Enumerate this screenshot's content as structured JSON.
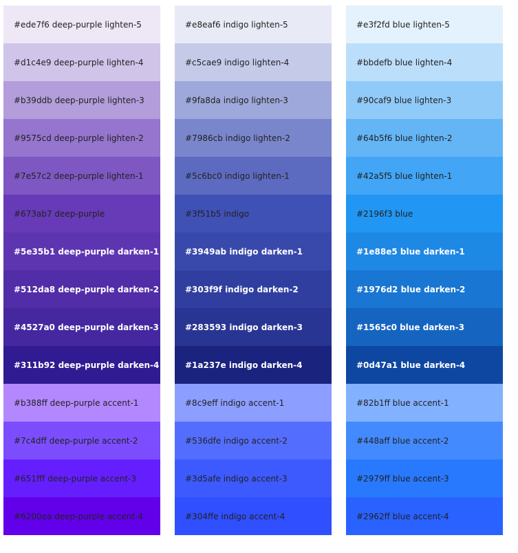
{
  "columns": [
    {
      "name": "deep-purple",
      "swatches": [
        {
          "color": "#ede7f6",
          "label": "#ede7f6 deep-purple lighten-5",
          "text": "light"
        },
        {
          "color": "#d1c4e9",
          "label": "#d1c4e9 deep-purple lighten-4",
          "text": "light"
        },
        {
          "color": "#b39ddb",
          "label": "#b39ddb deep-purple lighten-3",
          "text": "light"
        },
        {
          "color": "#9575cd",
          "label": "#9575cd deep-purple lighten-2",
          "text": "light"
        },
        {
          "color": "#7e57c2",
          "label": "#7e57c2 deep-purple lighten-1",
          "text": "light"
        },
        {
          "color": "#673ab7",
          "label": "#673ab7 deep-purple",
          "text": "light"
        },
        {
          "color": "#5e35b1",
          "label": "#5e35b1 deep-purple darken-1",
          "text": "dark"
        },
        {
          "color": "#512da8",
          "label": "#512da8 deep-purple darken-2",
          "text": "dark"
        },
        {
          "color": "#4527a0",
          "label": "#4527a0 deep-purple darken-3",
          "text": "dark"
        },
        {
          "color": "#311b92",
          "label": "#311b92 deep-purple darken-4",
          "text": "dark"
        },
        {
          "color": "#b388ff",
          "label": "#b388ff deep-purple accent-1",
          "text": "light"
        },
        {
          "color": "#7c4dff",
          "label": "#7c4dff deep-purple accent-2",
          "text": "light"
        },
        {
          "color": "#651fff",
          "label": "#651fff deep-purple accent-3",
          "text": "light"
        },
        {
          "color": "#6200ea",
          "label": "#6200ea deep-purple accent-4",
          "text": "light"
        }
      ]
    },
    {
      "name": "indigo",
      "swatches": [
        {
          "color": "#e8eaf6",
          "label": "#e8eaf6 indigo lighten-5",
          "text": "light"
        },
        {
          "color": "#c5cae9",
          "label": "#c5cae9 indigo lighten-4",
          "text": "light"
        },
        {
          "color": "#9fa8da",
          "label": "#9fa8da indigo lighten-3",
          "text": "light"
        },
        {
          "color": "#7986cb",
          "label": "#7986cb indigo lighten-2",
          "text": "light"
        },
        {
          "color": "#5c6bc0",
          "label": "#5c6bc0 indigo lighten-1",
          "text": "light"
        },
        {
          "color": "#3f51b5",
          "label": "#3f51b5 indigo",
          "text": "light"
        },
        {
          "color": "#3949ab",
          "label": "#3949ab indigo darken-1",
          "text": "dark"
        },
        {
          "color": "#303f9f",
          "label": "#303f9f indigo darken-2",
          "text": "dark"
        },
        {
          "color": "#283593",
          "label": "#283593 indigo darken-3",
          "text": "dark"
        },
        {
          "color": "#1a237e",
          "label": "#1a237e indigo darken-4",
          "text": "dark"
        },
        {
          "color": "#8c9eff",
          "label": "#8c9eff indigo accent-1",
          "text": "light"
        },
        {
          "color": "#536dfe",
          "label": "#536dfe indigo accent-2",
          "text": "light"
        },
        {
          "color": "#3d5afe",
          "label": "#3d5afe indigo accent-3",
          "text": "light"
        },
        {
          "color": "#304ffe",
          "label": "#304ffe indigo accent-4",
          "text": "light"
        }
      ]
    },
    {
      "name": "blue",
      "swatches": [
        {
          "color": "#e3f2fd",
          "label": "#e3f2fd blue lighten-5",
          "text": "light"
        },
        {
          "color": "#bbdefb",
          "label": "#bbdefb blue lighten-4",
          "text": "light"
        },
        {
          "color": "#90caf9",
          "label": "#90caf9 blue lighten-3",
          "text": "light"
        },
        {
          "color": "#64b5f6",
          "label": "#64b5f6 blue lighten-2",
          "text": "light"
        },
        {
          "color": "#42a5f5",
          "label": "#42a5f5 blue lighten-1",
          "text": "light"
        },
        {
          "color": "#2196f3",
          "label": "#2196f3 blue",
          "text": "light"
        },
        {
          "color": "#1e88e5",
          "label": "#1e88e5 blue darken-1",
          "text": "dark"
        },
        {
          "color": "#1976d2",
          "label": "#1976d2 blue darken-2",
          "text": "dark"
        },
        {
          "color": "#1565c0",
          "label": "#1565c0 blue darken-3",
          "text": "dark"
        },
        {
          "color": "#0d47a1",
          "label": "#0d47a1 blue darken-4",
          "text": "dark"
        },
        {
          "color": "#82b1ff",
          "label": "#82b1ff blue accent-1",
          "text": "light"
        },
        {
          "color": "#448aff",
          "label": "#448aff blue accent-2",
          "text": "light"
        },
        {
          "color": "#2979ff",
          "label": "#2979ff blue accent-3",
          "text": "light"
        },
        {
          "color": "#2962ff",
          "label": "#2962ff blue accent-4",
          "text": "light"
        }
      ]
    }
  ]
}
